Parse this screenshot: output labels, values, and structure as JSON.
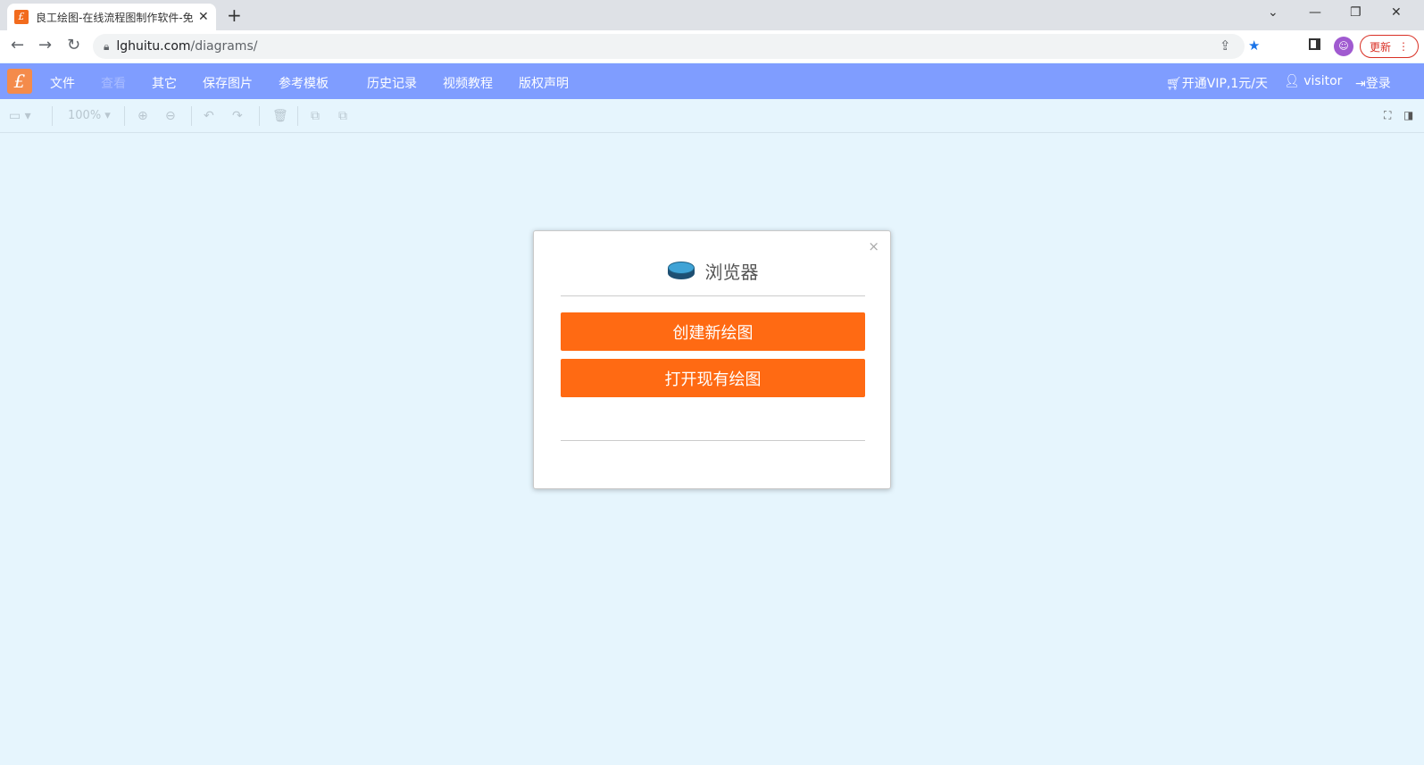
{
  "browser": {
    "tab_title": "良工绘图-在线流程图制作软件-免",
    "tab_favicon": "£",
    "url_host": "lghuitu.com",
    "url_path": "/diagrams/",
    "update_label": "更新"
  },
  "menubar": {
    "logo": "£",
    "items": [
      "文件",
      "查看",
      "其它",
      "保存图片",
      "参考模板",
      "历史记录",
      "视频教程",
      "版权声明"
    ],
    "vip_label": "开通VIP,1元/天",
    "user_label": "visitor",
    "login_label": "登录"
  },
  "toolbar": {
    "zoom": "100%"
  },
  "dialog": {
    "title": "浏览器",
    "create_label": "创建新绘图",
    "open_label": "打开现有绘图",
    "close_glyph": "×"
  },
  "colors": {
    "menubar": "#7f9dff",
    "primary_button": "#ff6a13",
    "canvas": "#e6f5fd"
  }
}
